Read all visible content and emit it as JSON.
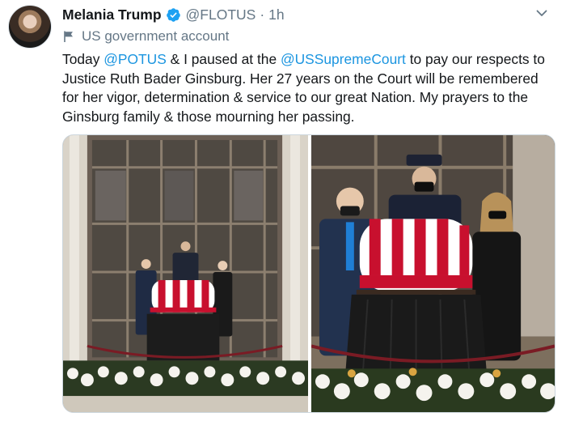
{
  "tweet": {
    "author": {
      "display_name": "Melania Trump",
      "handle": "@FLOTUS",
      "separator": "·",
      "time": "1h",
      "verified": true
    },
    "gov_label": "US government account",
    "text": {
      "t1": "Today ",
      "m1": "@POTUS",
      "t2": " & I paused at the ",
      "m2": "@USSupremeCourt",
      "t3": " to pay our respects to Justice Ruth Bader Ginsburg. Her 27 years on the Court will be remembered for her vigor, determination & service to our great Nation. My prayers to the Ginsburg family & those mourning her passing."
    },
    "media": [
      {
        "icon": "photo"
      },
      {
        "icon": "photo"
      }
    ]
  },
  "colors": {
    "link": "#1b95e0",
    "secondary_text": "#657786",
    "verified": "#1da1f2"
  },
  "icons": {
    "verified": "verified-badge-icon",
    "menu": "chevron-down-icon",
    "gov_label": "flag-icon"
  }
}
